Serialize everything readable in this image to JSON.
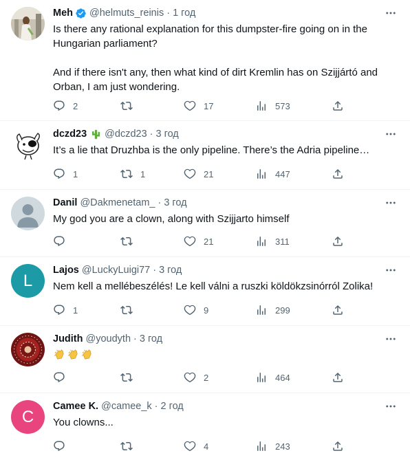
{
  "colors": {
    "verified": "#1d9bf0",
    "muted": "#536471",
    "lajos_avatar": "#1c9aa6",
    "camee_avatar": "#e8457f"
  },
  "tweets": [
    {
      "name": "Meh",
      "handle": "@helmuts_reinis",
      "time": "1 год",
      "verified": true,
      "text": "Is there any rational explanation for this dumpster-fire going on in the Hungarian parliament?\n\nAnd if there isn't any, then what kind of dirt Kremlin has on Szijjártó and Orban, I am just wondering.",
      "replies": "2",
      "retweets": "",
      "likes": "17",
      "views": "573"
    },
    {
      "name": "dczd23",
      "name_emoji": "cactus-icon",
      "handle": "@dczd23",
      "time": "3 год",
      "text": "It’s a lie that Druzhba is the only pipeline. There’s the Adria pipeline…",
      "replies": "1",
      "retweets": "1",
      "likes": "21",
      "views": "447"
    },
    {
      "name": "Danil",
      "handle": "@Dakmenetam_",
      "time": "3 год",
      "text": "My god you are a clown, along with Szijjarto himself",
      "replies": "",
      "retweets": "",
      "likes": "21",
      "views": "311"
    },
    {
      "name": "Lajos",
      "handle": "@LuckyLuigi77",
      "time": "3 год",
      "avatar_letter": "L",
      "text": "Nem kell a mellébeszélés! Le kell válni a ruszki köldökzsinórról Zolika!",
      "replies": "1",
      "retweets": "",
      "likes": "9",
      "views": "299"
    },
    {
      "name": "Judith",
      "handle": "@youdyth",
      "time": "3 год",
      "emojis": [
        "clapping-hands-icon",
        "clapping-hands-icon",
        "clapping-hands-icon"
      ],
      "replies": "",
      "retweets": "",
      "likes": "2",
      "views": "464"
    },
    {
      "name": "Camee K.",
      "handle": "@camee_k",
      "time": "2 год",
      "avatar_letter": "C",
      "text": "You clowns...",
      "replies": "",
      "retweets": "",
      "likes": "4",
      "views": "243"
    }
  ]
}
